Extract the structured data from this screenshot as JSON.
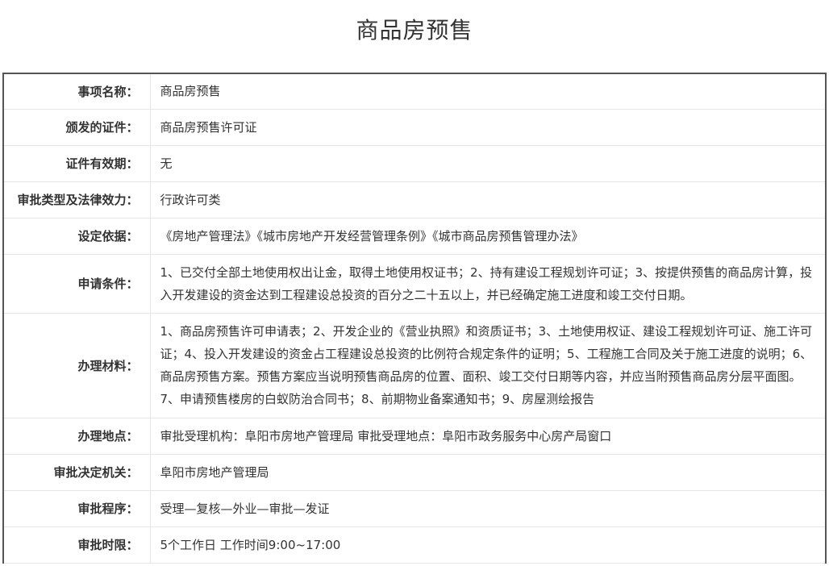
{
  "page": {
    "title": "商品房预售"
  },
  "rows": [
    {
      "label": "事项名称：",
      "value": "商品房预售"
    },
    {
      "label": "颁发的证件：",
      "value": "商品房预售许可证"
    },
    {
      "label": "证件有效期：",
      "value": "无"
    },
    {
      "label": "审批类型及法律效力：",
      "value": "行政许可类"
    },
    {
      "label": "设定依据：",
      "value": "《房地产管理法》《城市房地产开发经营管理条例》《城市商品房预售管理办法》"
    },
    {
      "label": "申请条件：",
      "value": "1、已交付全部土地使用权出让金，取得土地使用权证书；2、持有建设工程规划许可证；3、按提供预售的商品房计算，投入开发建设的资金达到工程建设总投资的百分之二十五以上，并已经确定施工进度和竣工交付日期。"
    },
    {
      "label": "办理材料：",
      "value": "1、商品房预售许可申请表；2、开发企业的《营业执照》和资质证书；3、土地使用权证、建设工程规划许可证、施工许可证；4、投入开发建设的资金占工程建设总投资的比例符合规定条件的证明；5、工程施工合同及关于施工进度的说明；6、商品房预售方案。预售方案应当说明预售商品房的位置、面积、竣工交付日期等内容，并应当附预售商品房分层平面图。7、申请预售楼房的白蚁防治合同书；8、前期物业备案通知书；9、房屋测绘报告"
    },
    {
      "label": "办理地点：",
      "value": "审批受理机构：阜阳市房地产管理局 审批受理地点：阜阳市政务服务中心房产局窗口"
    },
    {
      "label": "审批决定机关：",
      "value": "阜阳市房地产管理局"
    },
    {
      "label": "审批程序：",
      "value": "受理—复核—外业—审批—发证"
    },
    {
      "label": "审批时限：",
      "value": "5个工作日 工作时间9:00~17:00"
    }
  ]
}
